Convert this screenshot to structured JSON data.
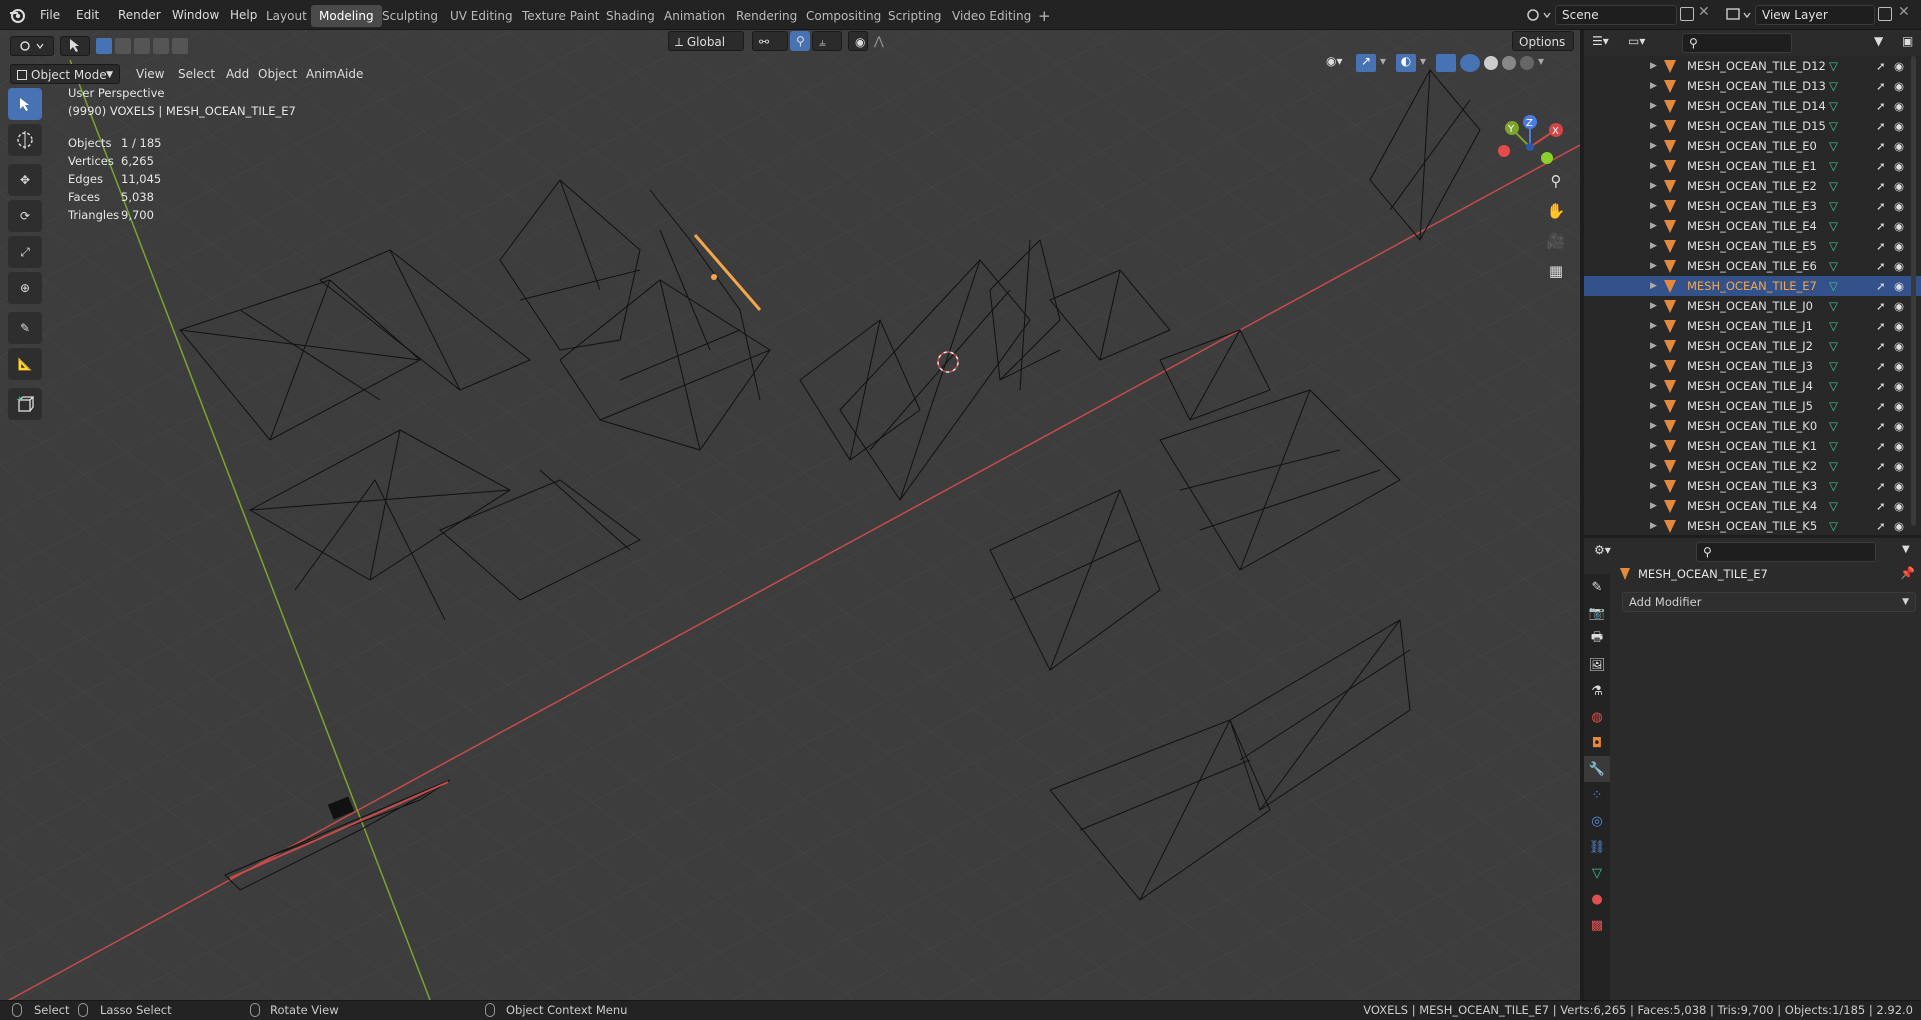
{
  "top_menu": [
    "File",
    "Edit",
    "Render",
    "Window",
    "Help"
  ],
  "workspaces": [
    "Layout",
    "Modeling",
    "Sculpting",
    "UV Editing",
    "Texture Paint",
    "Shading",
    "Animation",
    "Rendering",
    "Compositing",
    "Scripting",
    "Video Editing"
  ],
  "workspace_add": "+",
  "scene_label": "Scene",
  "view_layer_label": "View Layer",
  "viewport": {
    "mode": "Object Mode",
    "menus": [
      "View",
      "Select",
      "Add",
      "Object",
      "AnimAide"
    ],
    "orientation": "Global",
    "options": "Options",
    "perspective": "User Perspective",
    "active_object": "(9990) VOXELS | MESH_OCEAN_TILE_E7",
    "stats": [
      {
        "label": "Objects",
        "value": "1 / 185"
      },
      {
        "label": "Vertices",
        "value": "6,265"
      },
      {
        "label": "Edges",
        "value": "11,045"
      },
      {
        "label": "Faces",
        "value": "5,038"
      },
      {
        "label": "Triangles",
        "value": "9,700"
      }
    ],
    "gizmo": {
      "x": "X",
      "y": "Y",
      "z": "Z"
    }
  },
  "outliner": {
    "items": [
      {
        "name": "MESH_OCEAN_TILE_D12",
        "selected": false
      },
      {
        "name": "MESH_OCEAN_TILE_D13",
        "selected": false
      },
      {
        "name": "MESH_OCEAN_TILE_D14",
        "selected": false
      },
      {
        "name": "MESH_OCEAN_TILE_D15",
        "selected": false
      },
      {
        "name": "MESH_OCEAN_TILE_E0",
        "selected": false
      },
      {
        "name": "MESH_OCEAN_TILE_E1",
        "selected": false
      },
      {
        "name": "MESH_OCEAN_TILE_E2",
        "selected": false
      },
      {
        "name": "MESH_OCEAN_TILE_E3",
        "selected": false
      },
      {
        "name": "MESH_OCEAN_TILE_E4",
        "selected": false
      },
      {
        "name": "MESH_OCEAN_TILE_E5",
        "selected": false
      },
      {
        "name": "MESH_OCEAN_TILE_E6",
        "selected": false
      },
      {
        "name": "MESH_OCEAN_TILE_E7",
        "selected": true
      },
      {
        "name": "MESH_OCEAN_TILE_J0",
        "selected": false
      },
      {
        "name": "MESH_OCEAN_TILE_J1",
        "selected": false
      },
      {
        "name": "MESH_OCEAN_TILE_J2",
        "selected": false
      },
      {
        "name": "MESH_OCEAN_TILE_J3",
        "selected": false
      },
      {
        "name": "MESH_OCEAN_TILE_J4",
        "selected": false
      },
      {
        "name": "MESH_OCEAN_TILE_J5",
        "selected": false
      },
      {
        "name": "MESH_OCEAN_TILE_K0",
        "selected": false
      },
      {
        "name": "MESH_OCEAN_TILE_K1",
        "selected": false
      },
      {
        "name": "MESH_OCEAN_TILE_K2",
        "selected": false
      },
      {
        "name": "MESH_OCEAN_TILE_K3",
        "selected": false
      },
      {
        "name": "MESH_OCEAN_TILE_K4",
        "selected": false
      },
      {
        "name": "MESH_OCEAN_TILE_K5",
        "selected": false
      }
    ]
  },
  "properties": {
    "object_name": "MESH_OCEAN_TILE_E7",
    "add_modifier": "Add Modifier"
  },
  "status": {
    "select": "Select",
    "lasso": "Lasso Select",
    "rotate": "Rotate View",
    "context": "Object Context Menu",
    "info": "VOXELS | MESH_OCEAN_TILE_E7 | Verts:6,265 | Faces:5,038 | Tris:9,700 | Objects:1/185 | 2.92.0"
  },
  "colors": {
    "accent": "#4772b3",
    "selection": "#f5a64a",
    "x_axis": "#c84b4b",
    "y_axis": "#7fa32e",
    "mesh_icon": "#e58a3c",
    "data_icon": "#3fc88c"
  }
}
